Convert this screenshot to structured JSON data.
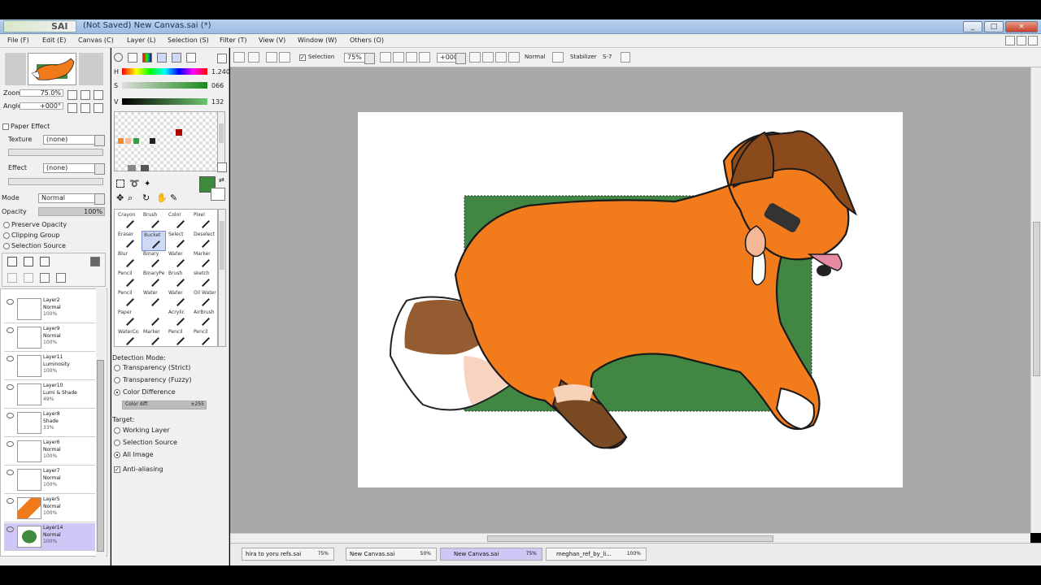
{
  "window": {
    "app_logo": "SAI",
    "title": "(Not Saved) New Canvas.sai (*)",
    "buttons": [
      "_",
      "□",
      "×"
    ]
  },
  "menu": [
    "File (F)",
    "Edit (E)",
    "Canvas (C)",
    "Layer (L)",
    "Selection (S)",
    "Filter (T)",
    "View (V)",
    "Window (W)",
    "Others (O)"
  ],
  "navigator": {
    "zoom_label": "Zoom",
    "zoom_value": "75.0%",
    "angle_label": "Angle",
    "angle_value": "+000°"
  },
  "paper_effect": {
    "header": "Paper Effect",
    "texture_label": "Texture",
    "texture_value": "(none)",
    "effect_label": "Effect",
    "effect_value": "(none)"
  },
  "layer_props": {
    "mode_label": "Mode",
    "mode_value": "Normal",
    "opacity_label": "Opacity",
    "opacity_value": "100%",
    "preserve_opacity": "Preserve Opacity",
    "clipping_group": "Clipping Group",
    "selection_source": "Selection Source"
  },
  "layers": [
    {
      "name": "Layer2",
      "mode": "Normal",
      "opacity": "100%",
      "selected": false
    },
    {
      "name": "Layer9",
      "mode": "Normal",
      "opacity": "100%",
      "selected": false
    },
    {
      "name": "Layer11",
      "mode": "Luminosity",
      "opacity": "100%",
      "selected": false
    },
    {
      "name": "Layer10",
      "mode": "Lumi & Shade",
      "opacity": "49%",
      "selected": false
    },
    {
      "name": "Layer8",
      "mode": "Shade",
      "opacity": "33%",
      "selected": false
    },
    {
      "name": "Layer6",
      "mode": "Normal",
      "opacity": "100%",
      "selected": false
    },
    {
      "name": "Layer7",
      "mode": "Normal",
      "opacity": "100%",
      "selected": false
    },
    {
      "name": "Layer5",
      "mode": "Normal",
      "opacity": "100%",
      "selected": false
    },
    {
      "name": "Layer14",
      "mode": "Normal",
      "opacity": "100%",
      "selected": true
    }
  ],
  "color": {
    "h_label": "H",
    "h_value": "1.240",
    "s_label": "S",
    "s_value": "066",
    "v_label": "V",
    "v_value": "132",
    "primary": "#3c8a3c",
    "swatch_colors": [
      "#f08a24",
      "#f4b89a",
      "#3a9a4a",
      "#222222",
      "#b00000"
    ]
  },
  "tools": [
    [
      "Crayon",
      "Brush",
      "Color",
      "Pixel"
    ],
    [
      "Eraser",
      "Bucket",
      "Select",
      "Deselect"
    ],
    [
      "Blur",
      "Binary",
      "Water",
      "Marker"
    ],
    [
      "Pencil",
      "BinaryPe",
      "Brush",
      "sketch"
    ],
    [
      "Pencil",
      "Water",
      "Water",
      "Oil Water"
    ],
    [
      "Paper",
      "",
      "Acrylic",
      "AirBrush"
    ],
    [
      "WaterCo",
      "Marker",
      "Pencil",
      "Pencil"
    ]
  ],
  "selected_tool": "Bucket",
  "bucket_options": {
    "detection_header": "Detection Mode:",
    "detection": [
      "Transparency (Strict)",
      "Transparency (Fuzzy)",
      "Color Difference"
    ],
    "detection_selected": 2,
    "color_diff_label": "Color diff.",
    "color_diff_value": "±255",
    "target_header": "Target:",
    "target": [
      "Working Layer",
      "Selection Source",
      "All Image"
    ],
    "target_selected": 2,
    "antialias": "Anti-aliasing"
  },
  "canvas_toolbar": {
    "selection_label": "Selection",
    "zoom": "75%",
    "angle": "+000°",
    "blend": "Normal",
    "stabilizer_label": "Stabilizer",
    "stabilizer_value": "S-7"
  },
  "tabs": [
    {
      "name": "hira to yoru refs.sai",
      "zoom": "75%",
      "selected": false
    },
    {
      "name": "New Canvas.sai",
      "zoom": "50%",
      "selected": false
    },
    {
      "name": "New Canvas.sai",
      "zoom": "75%",
      "selected": true
    },
    {
      "name": "meghan_ref_by_li...",
      "zoom": "100%",
      "selected": false
    }
  ]
}
